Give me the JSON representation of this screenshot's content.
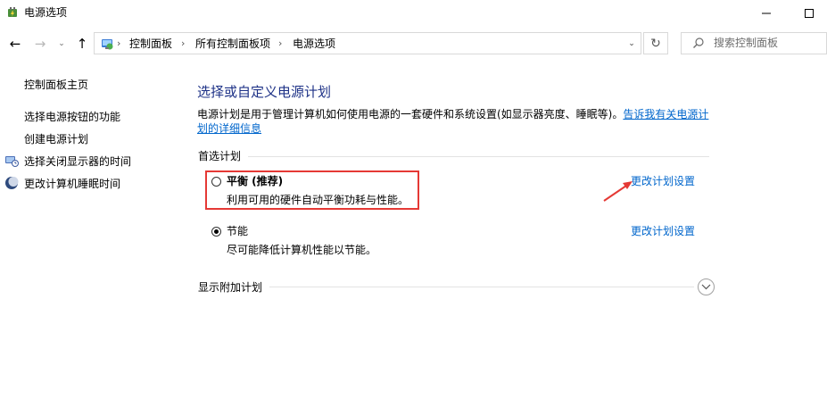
{
  "window": {
    "title": "电源选项"
  },
  "nav": {
    "back_glyph": "←",
    "forward_glyph": "→",
    "history_glyph": "⌄",
    "up_glyph": "↑",
    "breadcrumb": [
      "控制面板",
      "所有控制面板项",
      "电源选项"
    ],
    "separator": "›",
    "dropdown_glyph": "⌄",
    "refresh_glyph": "↻"
  },
  "search": {
    "placeholder": "搜索控制面板"
  },
  "sidebar": {
    "home_link": "控制面板主页",
    "links": [
      {
        "label": "选择电源按钮的功能",
        "icon": null
      },
      {
        "label": "创建电源计划",
        "icon": null
      },
      {
        "label": "选择关闭显示器的时间",
        "icon": "monitor-clock-icon"
      },
      {
        "label": "更改计算机睡眠时间",
        "icon": "moon-icon"
      }
    ]
  },
  "main": {
    "title": "选择或自定义电源计划",
    "description": "电源计划是用于管理计算机如何使用电源的一套硬件和系统设置(如显示器亮度、睡眠等)。",
    "description_link": "告诉我有关电源计划的详细信息",
    "preferred_label": "首选计划",
    "plans": [
      {
        "name": "平衡 (推荐)",
        "description": "利用可用的硬件自动平衡功耗与性能。",
        "selected": false,
        "link": "更改计划设置"
      },
      {
        "name": "节能",
        "description": "尽可能降低计算机性能以节能。",
        "selected": true,
        "link": "更改计划设置"
      }
    ],
    "more_plans_label": "显示附加计划"
  },
  "colors": {
    "title_blue": "#1e3287",
    "link_blue": "#0066cc",
    "highlight_red": "#e53935"
  }
}
